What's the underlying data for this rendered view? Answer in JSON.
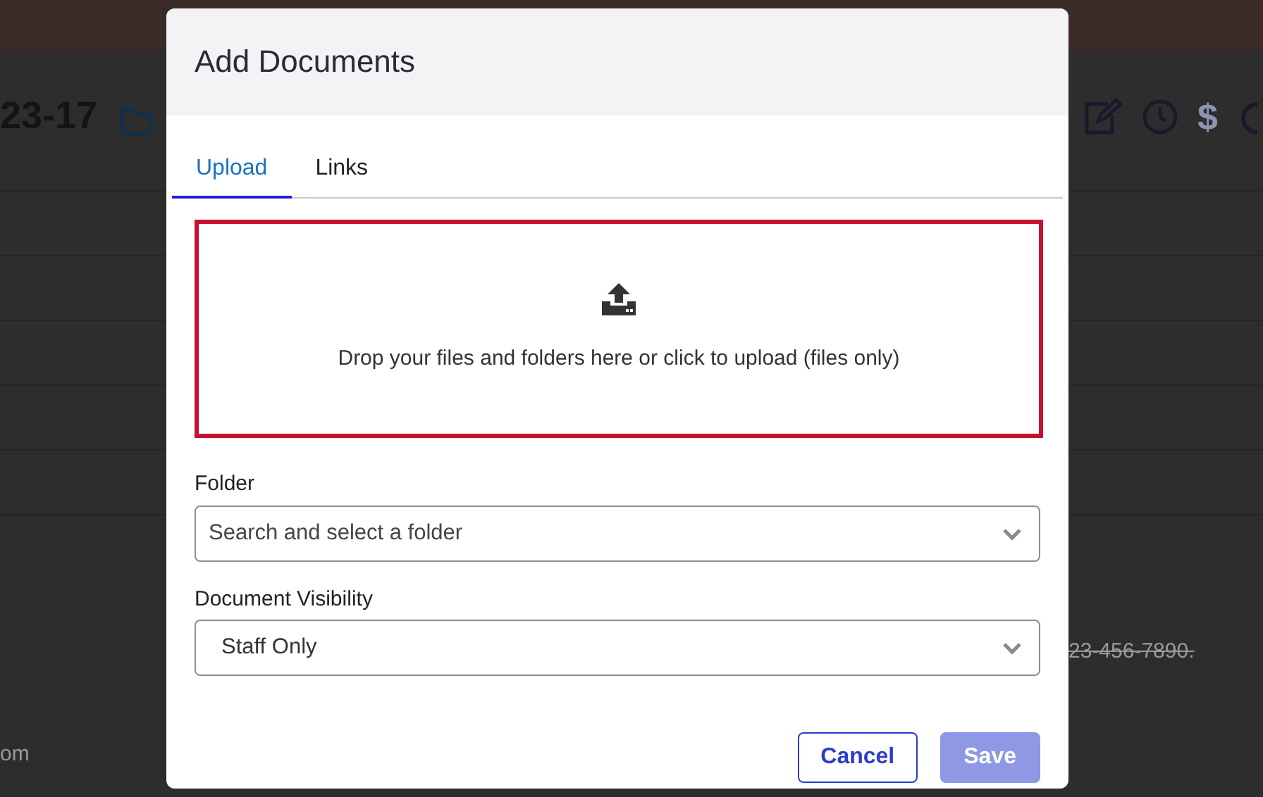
{
  "background": {
    "record_title": "23-17",
    "dollar_glyph": "$",
    "phone_text": "23-456-7890.",
    "email_fragment": "om"
  },
  "modal": {
    "title": "Add Documents",
    "tabs": [
      {
        "label": "Upload",
        "selected": true
      },
      {
        "label": "Links",
        "selected": false
      }
    ],
    "dropzone": {
      "text": "Drop your files and folders here or click to upload (files only)",
      "invalid": true
    },
    "fields": [
      {
        "label": "Folder",
        "placeholder": "Search and select a folder"
      },
      {
        "label": "Document Visibility",
        "value": "Staff Only"
      }
    ],
    "buttons": [
      {
        "label": "Cancel",
        "kind": "secondary",
        "disabled": false
      },
      {
        "label": "Save",
        "kind": "primary",
        "disabled": true
      }
    ]
  }
}
